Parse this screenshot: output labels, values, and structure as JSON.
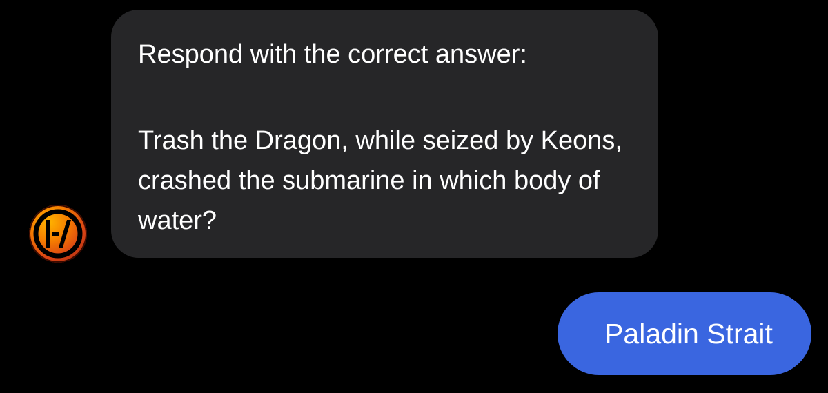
{
  "conversation": {
    "incoming": {
      "line1": "Respond with the correct answer:",
      "question": "Trash the Dragon, while seized by Keons, crashed the submarine in which body of water?"
    },
    "outgoing": {
      "text": "Paladin Strait"
    },
    "avatar_icon": "twenty-one-pilots-logo-icon"
  },
  "colors": {
    "background": "#000000",
    "incoming_bubble": "#262628",
    "outgoing_bubble": "#3a66e0",
    "text": "#ffffff"
  }
}
